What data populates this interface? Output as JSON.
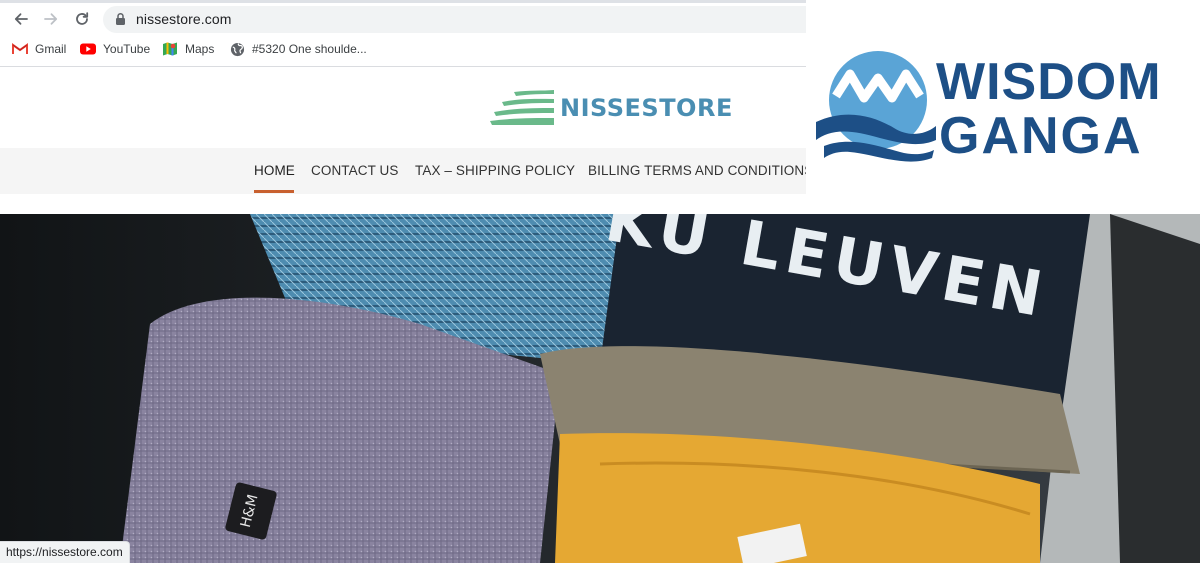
{
  "browser": {
    "url": "nissestore.com",
    "bookmarks": [
      {
        "label": "Gmail",
        "icon": "gmail-icon"
      },
      {
        "label": "YouTube",
        "icon": "youtube-icon"
      },
      {
        "label": "Maps",
        "icon": "maps-icon"
      },
      {
        "label": "#5320 One shoulde...",
        "icon": "globe-icon"
      }
    ],
    "status_url": "https://nissestore.com"
  },
  "site": {
    "logo_text": "NISSESTORE",
    "menu": [
      {
        "label": "HOME",
        "active": true
      },
      {
        "label": "CONTACT US",
        "active": false
      },
      {
        "label": "TAX – SHIPPING POLICY",
        "active": false
      },
      {
        "label": "BILLING TERMS AND CONDITIONS",
        "active": false
      }
    ],
    "accent_color": "#c8602f",
    "logo_color": "#4a8eb2",
    "logo_wave_color": "#6ab98a"
  },
  "hero": {
    "image_text": "KU LEUVEN",
    "tag_text": "H&M"
  },
  "watermark": {
    "line1": "WISDOM",
    "line2": "GANGA",
    "color": "#1d4f86"
  }
}
